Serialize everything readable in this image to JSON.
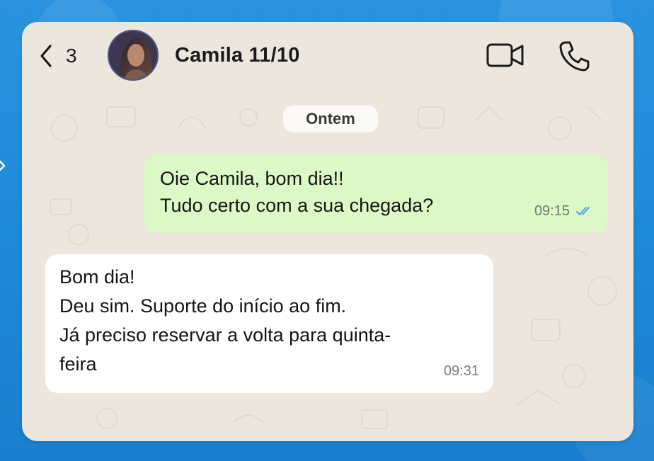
{
  "header": {
    "back_count": "3",
    "contact_name": "Camila 11/10"
  },
  "chat": {
    "date_separator": "Ontem",
    "messages": [
      {
        "direction": "outgoing",
        "lines": [
          "Oie Camila, bom dia!!",
          "Tudo certo com a sua chegada?"
        ],
        "time": "09:15",
        "status": "read"
      },
      {
        "direction": "incoming",
        "lines": [
          "Bom dia!",
          "Deu sim. Suporte do início ao fim.",
          "Já preciso reservar a volta para quinta-",
          "feira"
        ],
        "time": "09:31"
      }
    ]
  },
  "colors": {
    "page_background": "#1f8fdc",
    "chat_wallpaper": "#ece6dc",
    "outgoing_bubble": "#dbf8c6",
    "incoming_bubble": "#ffffff",
    "read_ticks": "#4fa3e8"
  },
  "icons": [
    "chevron-left-icon",
    "video-call-icon",
    "phone-icon",
    "double-check-icon"
  ]
}
